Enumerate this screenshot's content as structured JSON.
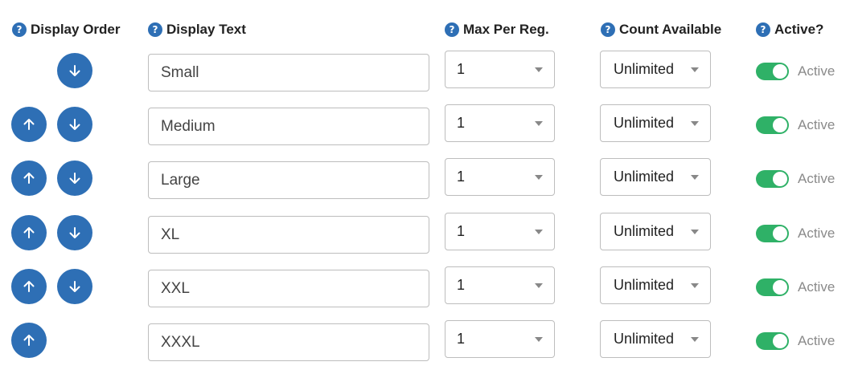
{
  "headers": {
    "help_icon_glyph": "?",
    "display_order": "Display Order",
    "display_text": "Display Text",
    "max_per_reg": "Max Per Reg.",
    "count_available": "Count Available",
    "active": "Active?"
  },
  "colors": {
    "accent": "#2e6fb5",
    "toggle_on": "#2fb167",
    "toggle_label": "#8a8a8a"
  },
  "rows": [
    {
      "display_text": "Small",
      "max_per_reg": "1",
      "count_available": "Unlimited",
      "active_label": "Active",
      "active": true,
      "show_up": false,
      "show_down": true
    },
    {
      "display_text": "Medium",
      "max_per_reg": "1",
      "count_available": "Unlimited",
      "active_label": "Active",
      "active": true,
      "show_up": true,
      "show_down": true
    },
    {
      "display_text": "Large",
      "max_per_reg": "1",
      "count_available": "Unlimited",
      "active_label": "Active",
      "active": true,
      "show_up": true,
      "show_down": true
    },
    {
      "display_text": "XL",
      "max_per_reg": "1",
      "count_available": "Unlimited",
      "active_label": "Active",
      "active": true,
      "show_up": true,
      "show_down": true
    },
    {
      "display_text": "XXL",
      "max_per_reg": "1",
      "count_available": "Unlimited",
      "active_label": "Active",
      "active": true,
      "show_up": true,
      "show_down": true
    },
    {
      "display_text": "XXXL",
      "max_per_reg": "1",
      "count_available": "Unlimited",
      "active_label": "Active",
      "active": true,
      "show_up": true,
      "show_down": false
    }
  ],
  "icons": {
    "help": "question-circle-icon",
    "up": "arrow-up-icon",
    "down": "arrow-down-icon",
    "caret": "caret-down-icon"
  }
}
